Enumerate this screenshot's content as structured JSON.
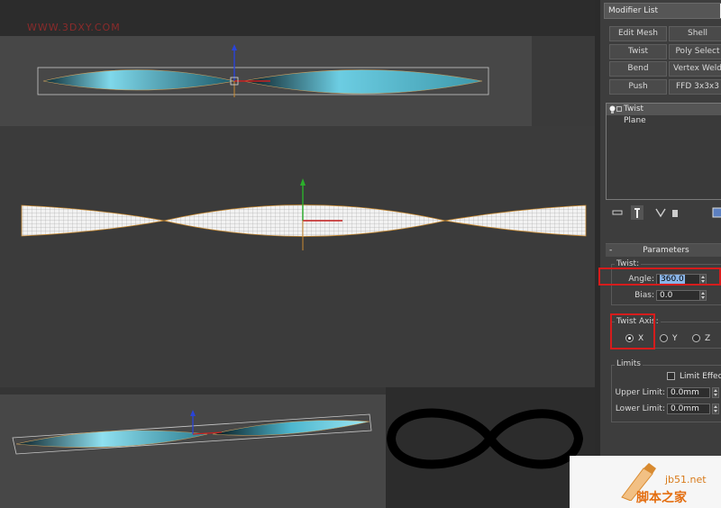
{
  "watermarks": {
    "top": "WWW.3DXY.COM",
    "bottom_site": "jb51.net",
    "bottom_cn": "脚本之家"
  },
  "modifier_list": {
    "label": "Modifier List"
  },
  "modifier_buttons": [
    "Edit Mesh",
    "Shell",
    "Twist",
    "Poly Select",
    "Bend",
    "Vertex Weld",
    "Push",
    "FFD 3x3x3"
  ],
  "stack": {
    "items": [
      {
        "label": "Twist",
        "selected": true
      },
      {
        "label": "Plane",
        "selected": false
      }
    ]
  },
  "parameters": {
    "rollout_title": "Parameters",
    "twist_group": "Twist:",
    "angle_label": "Angle:",
    "angle_value": "360.0",
    "bias_label": "Bias:",
    "bias_value": "0.0",
    "twist_axis_group": "Twist Axis:",
    "axis_options": [
      "X",
      "Y",
      "Z"
    ],
    "axis_selected": "X",
    "limits_group": "Limits",
    "limit_effect_label": "Limit Effect",
    "upper_limit_label": "Upper Limit:",
    "upper_limit_value": "0.0mm",
    "lower_limit_label": "Lower Limit:",
    "lower_limit_value": "0.0mm"
  },
  "colors": {
    "highlight_box": "#d61c1c",
    "mesh_fill": "#5fc0d6",
    "gizmo_orange": "#c98a30"
  }
}
